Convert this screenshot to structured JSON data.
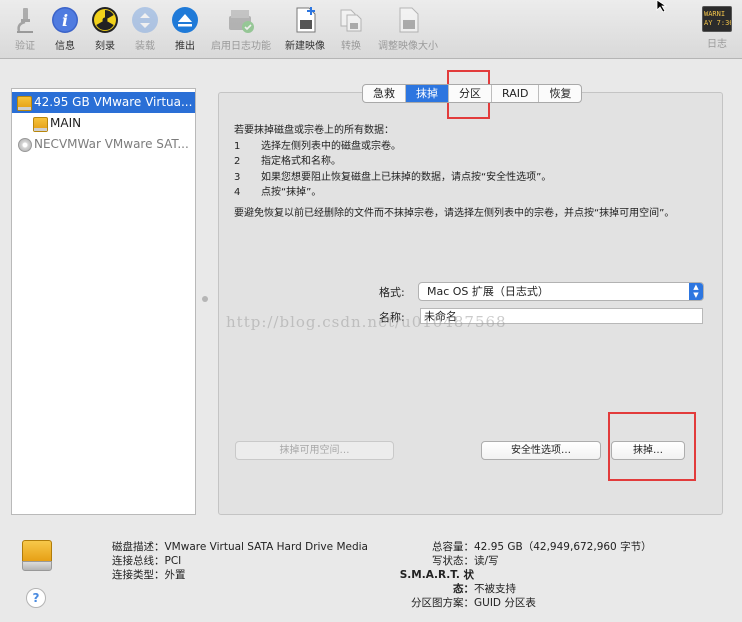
{
  "toolbar": {
    "items": [
      {
        "label": "验证",
        "icon": "microscope-icon",
        "disabled": true
      },
      {
        "label": "信息",
        "icon": "info-icon",
        "disabled": false
      },
      {
        "label": "刻录",
        "icon": "burn-icon",
        "disabled": false
      },
      {
        "label": "装载",
        "icon": "mount-icon",
        "disabled": true
      },
      {
        "label": "推出",
        "icon": "eject-icon",
        "disabled": false
      },
      {
        "label": "启用日志功能",
        "icon": "journal-icon",
        "disabled": true
      },
      {
        "label": "新建映像",
        "icon": "new-image-icon",
        "disabled": false
      },
      {
        "label": "转换",
        "icon": "convert-icon",
        "disabled": true
      },
      {
        "label": "调整映像大小",
        "icon": "resize-image-icon",
        "disabled": true
      }
    ],
    "log": {
      "label": "日志",
      "screen_text": "WARNI\nAY 7:36"
    }
  },
  "disks": [
    {
      "name": "42.95 GB VMware Virtua...",
      "type": "disk",
      "selected": true
    },
    {
      "name": "MAIN",
      "type": "volume",
      "selected": false
    },
    {
      "name": "NECVMWar VMware SAT...",
      "type": "cd",
      "selected": false
    }
  ],
  "tabs": [
    {
      "label": "急救",
      "active": false
    },
    {
      "label": "抹掉",
      "active": true
    },
    {
      "label": "分区",
      "active": false
    },
    {
      "label": "RAID",
      "active": false
    },
    {
      "label": "恢复",
      "active": false
    }
  ],
  "erase": {
    "intro": "若要抹掉磁盘或宗卷上的所有数据：",
    "steps": [
      {
        "num": "1",
        "text": "选择左侧列表中的磁盘或宗卷。"
      },
      {
        "num": "2",
        "text": "指定格式和名称。"
      },
      {
        "num": "3",
        "text": "如果您想要阻止恢复磁盘上已抹掉的数据，请点按“安全性选项”。"
      },
      {
        "num": "4",
        "text": "点按“抹掉”。"
      }
    ],
    "note": "要避免恢复以前已经删除的文件而不抹掉宗卷，请选择左侧列表中的宗卷，并点按“抹掉可用空间”。",
    "format_label": "格式:",
    "format_value": "Mac OS 扩展（日志式）",
    "name_label": "名称:",
    "name_value": "未命名",
    "erase_free_space_button": "抹掉可用空间…",
    "security_options_button": "安全性选项…",
    "erase_button": "抹掉…"
  },
  "watermark": "http://blog.csdn.net/u010487568",
  "details": {
    "left": [
      {
        "key": "磁盘描述：",
        "value": "VMware Virtual SATA Hard Drive Media"
      },
      {
        "key": "连接总线：",
        "value": "PCI"
      },
      {
        "key": "连接类型：",
        "value": "外置"
      }
    ],
    "right": [
      {
        "key": "总容量：",
        "value": "42.95 GB（42,949,672,960 字节）"
      },
      {
        "key": "写状态：",
        "value": "读/写"
      },
      {
        "key": "S.M.A.R.T. 状态：",
        "value": "不被支持"
      },
      {
        "key": "分区图方案：",
        "value": "GUID 分区表"
      }
    ]
  },
  "help_symbol": "?",
  "colors": {
    "accent": "#2d76e0",
    "selection": "#2a6fd6",
    "annotation": "#e23b3b"
  }
}
